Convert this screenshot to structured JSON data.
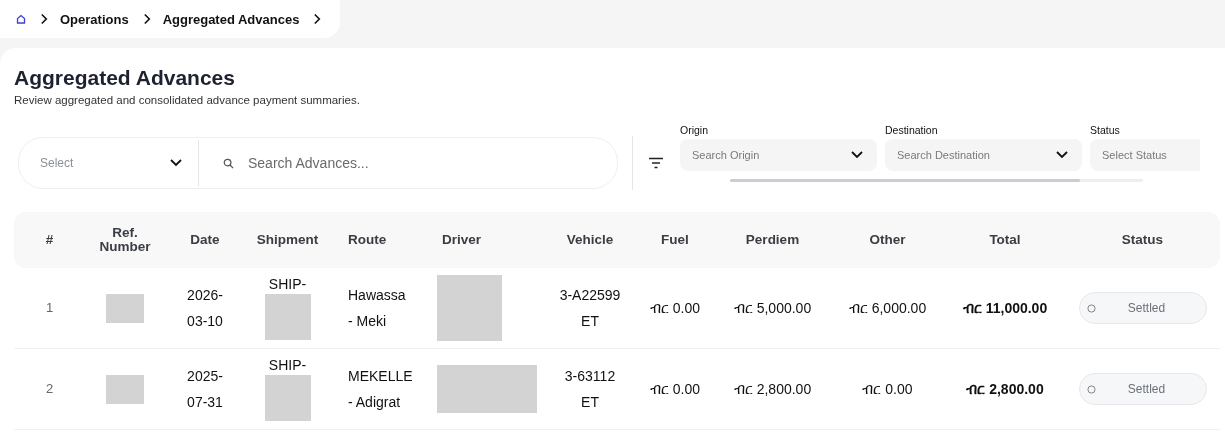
{
  "breadcrumb": [
    "Operations",
    "Aggregated Advances"
  ],
  "page": {
    "title": "Aggregated Advances",
    "subtitle": "Review aggregated and consolidated advance payment summaries."
  },
  "toolbar": {
    "select": {
      "placeholder": "Select"
    },
    "search": {
      "placeholder": "Search Advances..."
    },
    "filters": [
      {
        "label": "Origin",
        "placeholder": "Search Origin",
        "kind": "dropdown"
      },
      {
        "label": "Destination",
        "placeholder": "Search Destination",
        "kind": "dropdown"
      },
      {
        "label": "Status",
        "placeholder": "Select Status",
        "kind": "select"
      }
    ]
  },
  "table": {
    "columns": [
      "#",
      "Ref. Number",
      "Date",
      "Shipment",
      "Route",
      "Driver",
      "Vehicle",
      "Fuel",
      "Perdiem",
      "Other",
      "Total",
      "Status"
    ],
    "rows": [
      {
        "index": "1",
        "ref": {
          "redacted": true
        },
        "date": "2026-03-10",
        "shipment": {
          "text": "SHIP-",
          "redacted": true
        },
        "route": "Hawassa - Meki",
        "driver": {
          "redacted": true
        },
        "vehicle": "3-A22599 ET",
        "fuel": "ብር 0.00",
        "perdiem": "ብር 5,000.00",
        "other": "ብር 6,000.00",
        "total": "ብር 11,000.00",
        "status": "Settled"
      },
      {
        "index": "2",
        "ref": {
          "redacted": true
        },
        "date": "2025-07-31",
        "shipment": {
          "text": "SHIP-",
          "redacted": true
        },
        "route": "MEKELLE - Adigrat",
        "driver": {
          "redacted": true
        },
        "vehicle": "3-63112 ET",
        "fuel": "ብር 0.00",
        "perdiem": "ብር 2,800.00",
        "other": "ብር 0.00",
        "total": "ብር 2,800.00",
        "status": "Settled"
      }
    ]
  }
}
